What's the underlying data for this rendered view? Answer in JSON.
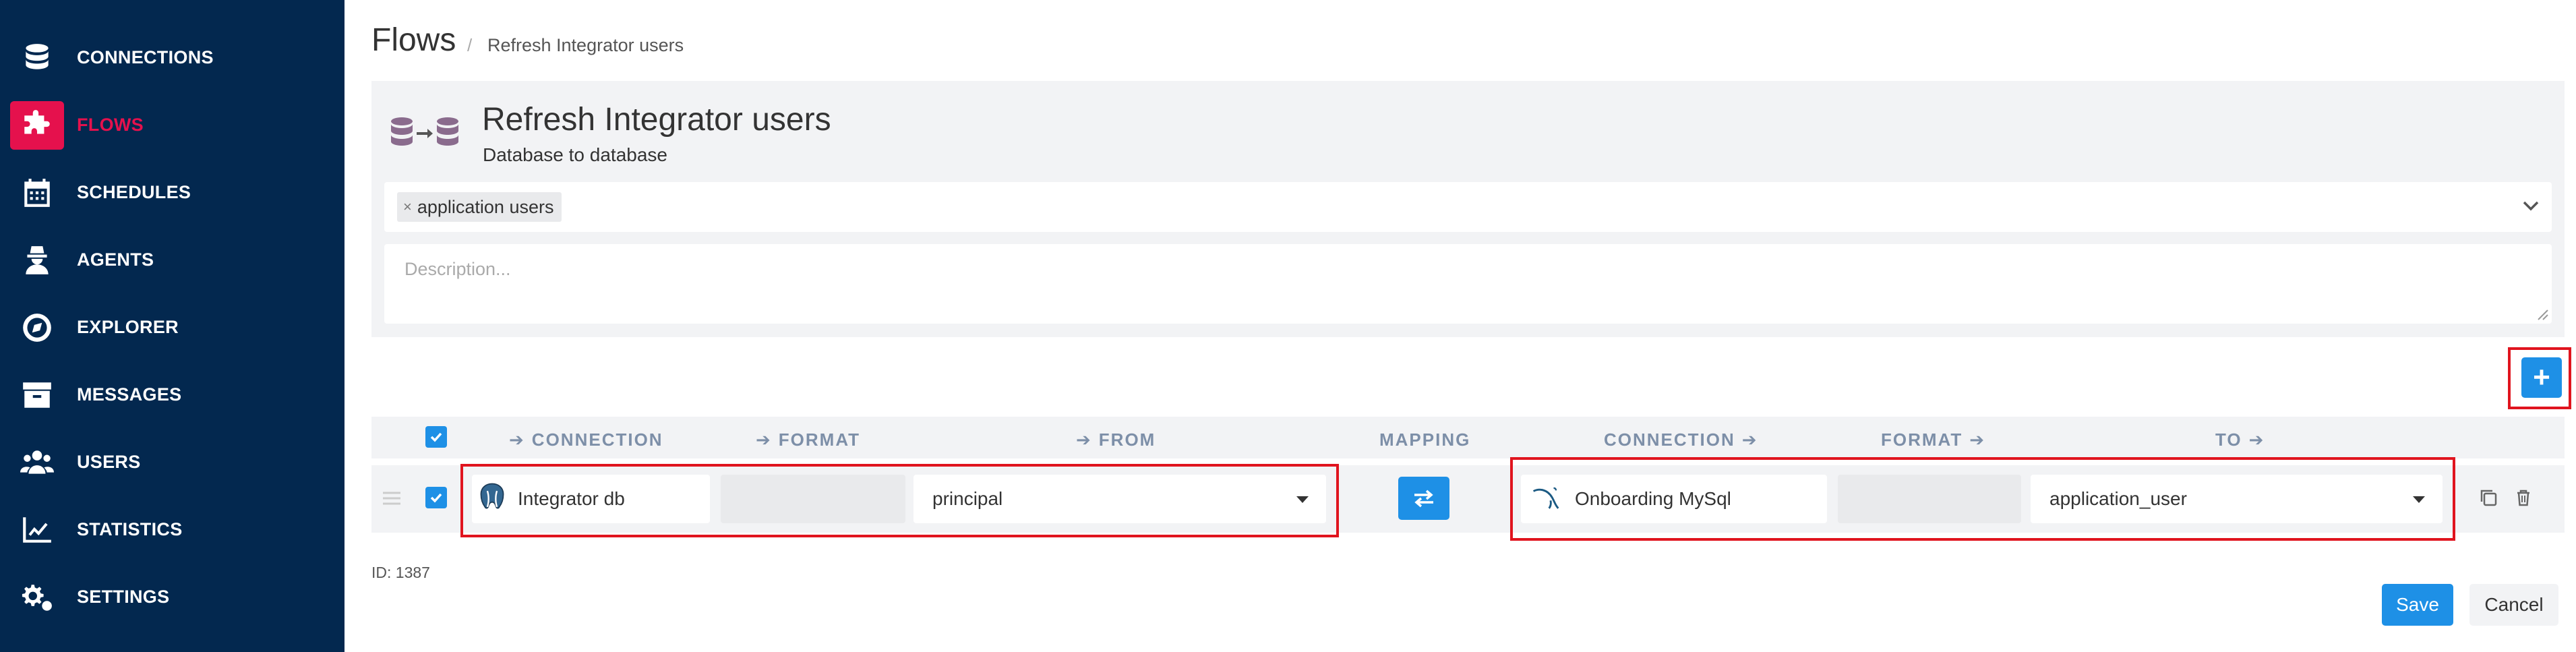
{
  "sidebar": {
    "items": [
      {
        "label": "CONNECTIONS",
        "icon": "database-icon"
      },
      {
        "label": "FLOWS",
        "icon": "puzzle-icon",
        "active": true
      },
      {
        "label": "SCHEDULES",
        "icon": "calendar-icon"
      },
      {
        "label": "AGENTS",
        "icon": "agent-icon"
      },
      {
        "label": "EXPLORER",
        "icon": "compass-icon"
      },
      {
        "label": "MESSAGES",
        "icon": "archive-icon"
      },
      {
        "label": "USERS",
        "icon": "users-icon"
      },
      {
        "label": "STATISTICS",
        "icon": "chart-line-icon"
      },
      {
        "label": "SETTINGS",
        "icon": "gears-icon"
      }
    ]
  },
  "header": {
    "title": "Flows",
    "breadcrumb_separator": "/",
    "breadcrumb": "Refresh Integrator users"
  },
  "flow": {
    "title": "Refresh Integrator users",
    "subtitle": "Database to database",
    "tags": [
      {
        "label": "application users",
        "remove": "×"
      }
    ],
    "description_placeholder": "Description..."
  },
  "table": {
    "headers": {
      "source_connection": "CONNECTION",
      "source_format": "FORMAT",
      "from": "FROM",
      "mapping": "MAPPING",
      "target_connection": "CONNECTION",
      "target_format": "FORMAT",
      "to": "TO"
    },
    "row": {
      "source_connection": "Integrator db",
      "source_format": "",
      "from": "principal",
      "target_connection": "Onboarding MySql",
      "target_format": "",
      "to": "application_user"
    }
  },
  "footer": {
    "id_label": "ID: 1387",
    "save_label": "Save",
    "cancel_label": "Cancel"
  },
  "colors": {
    "sidebar_bg": "#03284f",
    "accent": "#e5114d",
    "primary": "#1e90e6",
    "highlight": "#e0141e"
  }
}
